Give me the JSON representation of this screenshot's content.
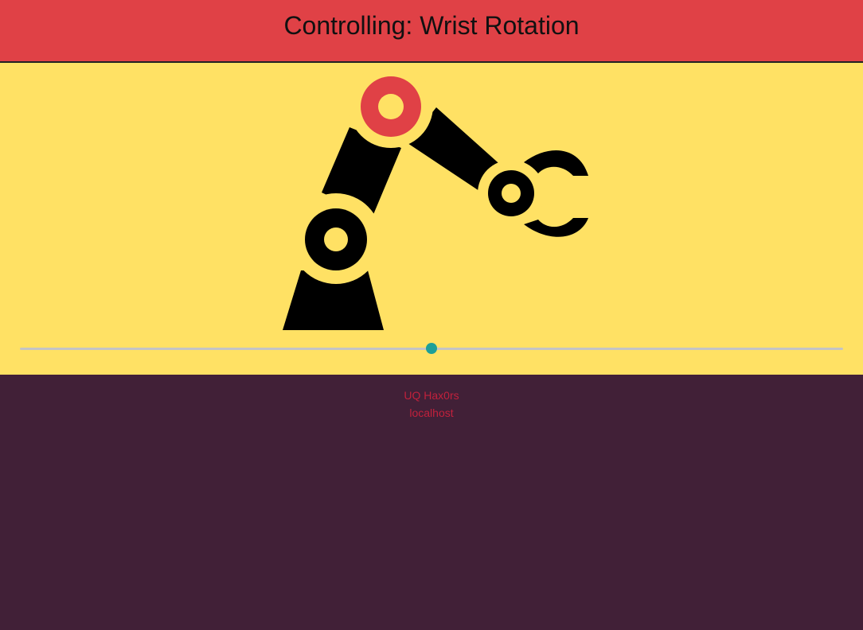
{
  "header": {
    "title": "Controlling: Wrist Rotation"
  },
  "control": {
    "slider_value": 0.5
  },
  "footer": {
    "team": "UQ Hax0rs",
    "host": "localhost"
  },
  "colors": {
    "header_bg": "#e04146",
    "panel_bg": "#ffe164",
    "page_bg": "#412037",
    "accent_joint": "#e04146",
    "slider_thumb": "#1e9f98",
    "footer_text": "#c2203c"
  },
  "icons": {
    "robot_arm": "robotic-arm-icon"
  }
}
